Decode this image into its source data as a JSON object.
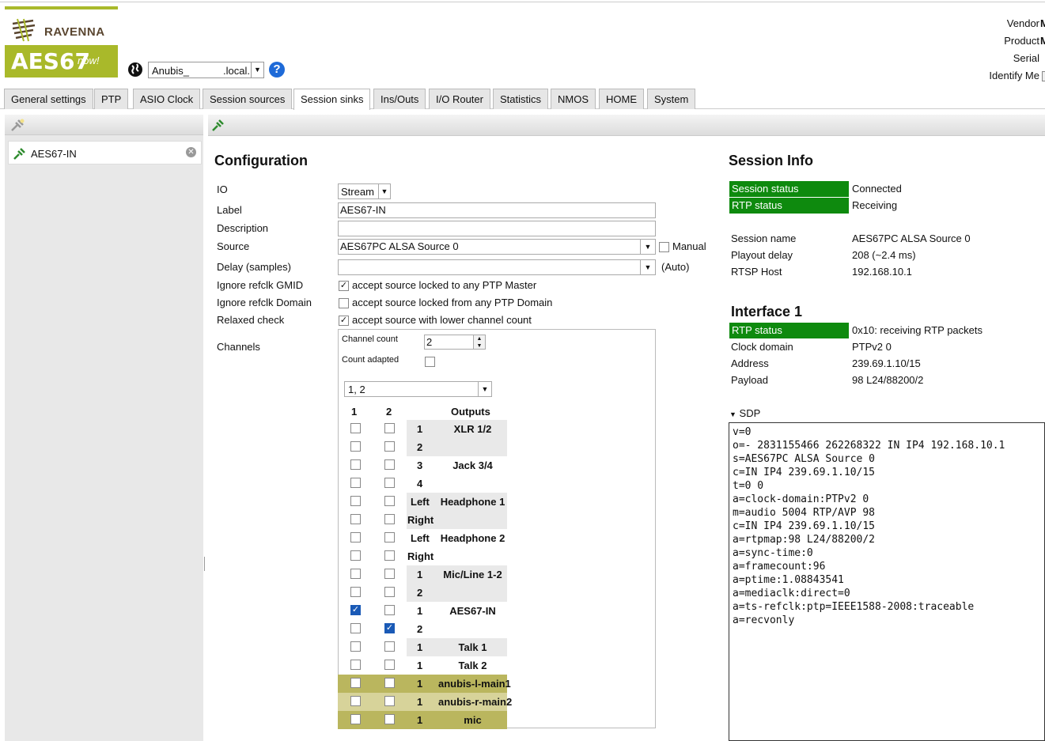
{
  "header": {
    "brand": "RAVENNA",
    "logo_main": "AES67",
    "logo_tag": "now!",
    "host_part1": "Anubis_",
    "host_part2": ".local.",
    "help_icon": "?",
    "vendor_label": "Vendor",
    "vendor_value": "Me",
    "product_label": "Product",
    "product_value": "MI",
    "serial_label": "Serial",
    "identify_label": "Identify Me"
  },
  "tabs": [
    "General settings",
    "PTP",
    "ASIO Clock",
    "Session sources",
    "Session sinks",
    "Ins/Outs",
    "I/O Router",
    "Statistics",
    "NMOS",
    "HOME",
    "System"
  ],
  "active_tab": "Session sinks",
  "sidebar": {
    "items": [
      {
        "label": "AES67-IN"
      }
    ]
  },
  "config": {
    "title": "Configuration",
    "io_label": "IO",
    "io_value": "Stream",
    "label_label": "Label",
    "label_value": "AES67-IN",
    "description_label": "Description",
    "description_value": "",
    "source_label": "Source",
    "source_value": "AES67PC ALSA Source 0",
    "manual_label": "Manual",
    "delay_label": "Delay (samples)",
    "delay_value": "",
    "auto_label": "(Auto)",
    "gmid_label": "Ignore refclk GMID",
    "gmid_text": "accept source locked to any PTP Master",
    "gmid_checked": true,
    "domain_label": "Ignore refclk Domain",
    "domain_text": "accept source locked from any PTP Domain",
    "domain_checked": false,
    "relaxed_label": "Relaxed check",
    "relaxed_text": "accept source with lower channel count",
    "relaxed_checked": true,
    "channels_label": "Channels",
    "channel_count_label": "Channel count",
    "channel_count_value": "2",
    "count_adapted_label": "Count adapted",
    "channel_map_value": "1, 2",
    "grid_headers": [
      "1",
      "2",
      "Outputs"
    ],
    "grid_rows": [
      {
        "ch": "1",
        "out": "XLR 1/2",
        "c1": false,
        "c2": false,
        "bg": "shade"
      },
      {
        "ch": "2",
        "out": "",
        "c1": false,
        "c2": false,
        "bg": "shade"
      },
      {
        "ch": "3",
        "out": "Jack 3/4",
        "c1": false,
        "c2": false,
        "bg": "white"
      },
      {
        "ch": "4",
        "out": "",
        "c1": false,
        "c2": false,
        "bg": "white"
      },
      {
        "ch": "Left",
        "out": "Headphone 1",
        "c1": false,
        "c2": false,
        "bg": "shade"
      },
      {
        "ch": "Right",
        "out": "",
        "c1": false,
        "c2": false,
        "bg": "shade"
      },
      {
        "ch": "Left",
        "out": "Headphone 2",
        "c1": false,
        "c2": false,
        "bg": "white"
      },
      {
        "ch": "Right",
        "out": "",
        "c1": false,
        "c2": false,
        "bg": "white"
      },
      {
        "ch": "1",
        "out": "Mic/Line 1-2",
        "c1": false,
        "c2": false,
        "bg": "shade"
      },
      {
        "ch": "2",
        "out": "",
        "c1": false,
        "c2": false,
        "bg": "shade"
      },
      {
        "ch": "1",
        "out": "AES67-IN",
        "c1": true,
        "c2": false,
        "bg": "white"
      },
      {
        "ch": "2",
        "out": "",
        "c1": false,
        "c2": true,
        "bg": "white"
      },
      {
        "ch": "1",
        "out": "Talk 1",
        "c1": false,
        "c2": false,
        "bg": "shade"
      },
      {
        "ch": "1",
        "out": "Talk 2",
        "c1": false,
        "c2": false,
        "bg": "white"
      },
      {
        "ch": "1",
        "out": "anubis-l-main1",
        "c1": false,
        "c2": false,
        "bg": "olive"
      },
      {
        "ch": "1",
        "out": "anubis-r-main2",
        "c1": false,
        "c2": false,
        "bg": "olive2"
      },
      {
        "ch": "1",
        "out": "mic",
        "c1": false,
        "c2": false,
        "bg": "olive"
      }
    ]
  },
  "session_info": {
    "title": "Session Info",
    "session_status_label": "Session status",
    "session_status_value": "Connected",
    "rtp_status_label": "RTP status",
    "rtp_status_value": "Receiving",
    "session_name_label": "Session name",
    "session_name_value": "AES67PC ALSA Source 0",
    "playout_label": "Playout delay",
    "playout_value": "208 (~2.4 ms)",
    "rtsp_label": "RTSP Host",
    "rtsp_value": "192.168.10.1"
  },
  "interface1": {
    "title": "Interface 1",
    "rtp_status_label": "RTP status",
    "rtp_status_value": "0x10: receiving RTP packets",
    "clock_label": "Clock domain",
    "clock_value": "PTPv2 0",
    "address_label": "Address",
    "address_value": "239.69.1.10/15",
    "payload_label": "Payload",
    "payload_value": "98 L24/88200/2"
  },
  "sdp": {
    "label": "SDP",
    "text": "v=0\no=- 2831155466 262268322 IN IP4 192.168.10.1\ns=AES67PC ALSA Source 0\nc=IN IP4 239.69.1.10/15\nt=0 0\na=clock-domain:PTPv2 0\nm=audio 5004 RTP/AVP 98\nc=IN IP4 239.69.1.10/15\na=rtpmap:98 L24/88200/2\na=sync-time:0\na=framecount:96\na=ptime:1.08843541\na=mediaclk:direct=0\na=ts-refclk:ptp=IEEE1588-2008:traceable\na=recvonly"
  },
  "colors": {
    "accent": "#a9b92a",
    "status_green": "#0e8a0e",
    "olive": "#bab65e",
    "olive_light": "#d7d39a"
  }
}
